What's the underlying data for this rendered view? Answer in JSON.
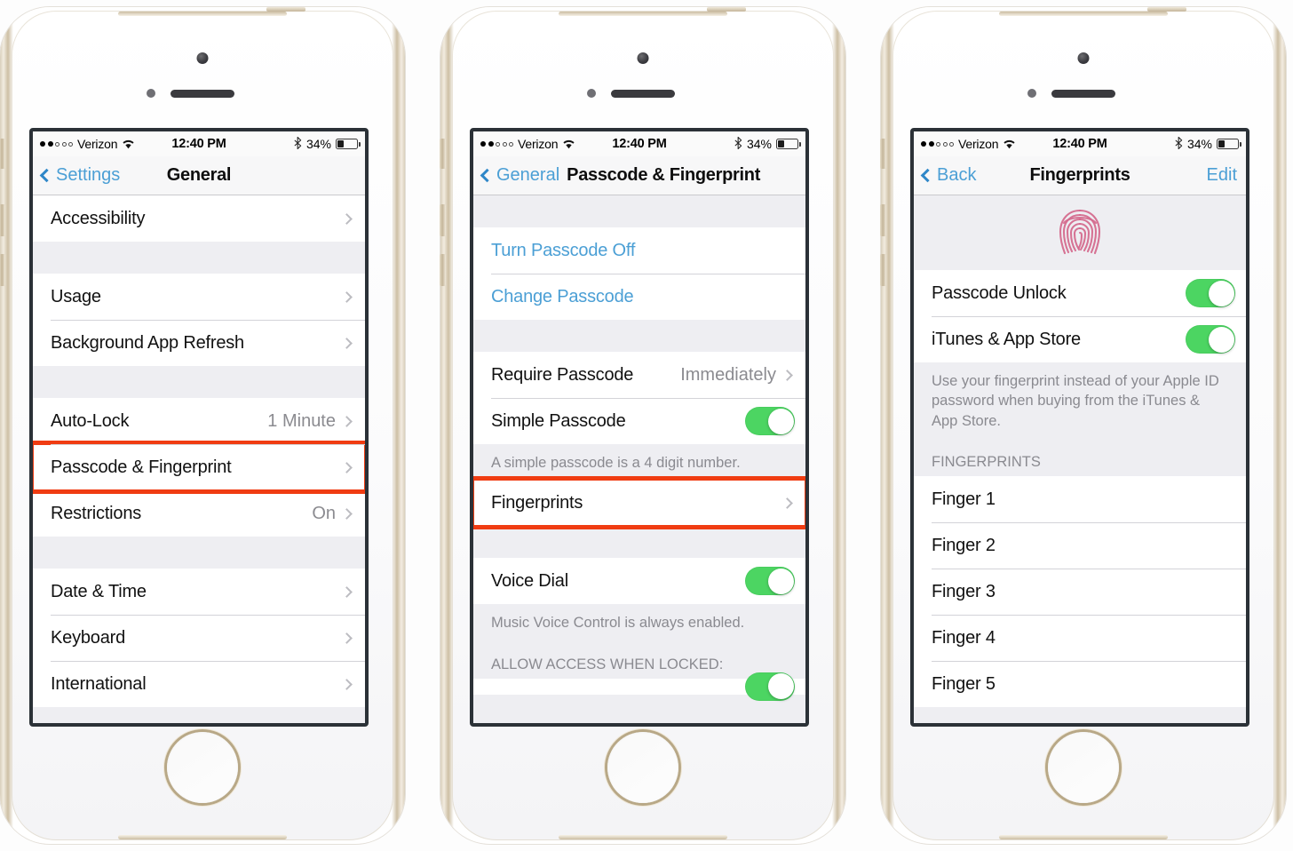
{
  "status_bar": {
    "carrier": "Verizon",
    "signal_dots_filled": 2,
    "signal_dots_total": 5,
    "wifi_icon": "wifi-icon",
    "time": "12:40 PM",
    "bluetooth_icon": "bluetooth-icon",
    "battery_percent": "34%",
    "battery_level": 34
  },
  "colors": {
    "accent_blue": "#4b9fd5",
    "toggle_green": "#4cd562",
    "highlight_red": "#f03c12",
    "fingerprint_pink": "#d4688c",
    "value_gray": "#8b8b90",
    "group_bg": "#eeeef2"
  },
  "phones": [
    {
      "id": "phone-general",
      "nav": {
        "back_label": "Settings",
        "title": "General",
        "title_centered": true,
        "edit_label": null
      },
      "sections": [
        {
          "top_gap": 0,
          "rows": [
            {
              "label": "Accessibility",
              "value": null,
              "chevron": true,
              "type": "link"
            }
          ],
          "footer": null
        },
        {
          "top_gap": 36,
          "rows": [
            {
              "label": "Usage",
              "value": null,
              "chevron": true,
              "type": "link"
            },
            {
              "label": "Background App Refresh",
              "value": null,
              "chevron": true,
              "type": "link"
            }
          ],
          "footer": null
        },
        {
          "top_gap": 36,
          "rows": [
            {
              "label": "Auto-Lock",
              "value": "1 Minute",
              "chevron": true,
              "type": "link"
            },
            {
              "label": "Passcode & Fingerprint",
              "value": null,
              "chevron": true,
              "type": "link",
              "highlighted": true
            },
            {
              "label": "Restrictions",
              "value": "On",
              "chevron": true,
              "type": "link"
            }
          ],
          "footer": null
        },
        {
          "top_gap": 36,
          "rows": [
            {
              "label": "Date & Time",
              "value": null,
              "chevron": true,
              "type": "link"
            },
            {
              "label": "Keyboard",
              "value": null,
              "chevron": true,
              "type": "link"
            },
            {
              "label": "International",
              "value": null,
              "chevron": true,
              "type": "link"
            }
          ],
          "footer": null
        }
      ]
    },
    {
      "id": "phone-passcode",
      "nav": {
        "back_label": "General",
        "title": "Passcode & Fingerprint",
        "title_centered": false,
        "edit_label": null
      },
      "sections": [
        {
          "top_gap": 36,
          "rows": [
            {
              "label": "Turn Passcode Off",
              "value": null,
              "chevron": false,
              "type": "action"
            },
            {
              "label": "Change Passcode",
              "value": null,
              "chevron": false,
              "type": "action"
            }
          ],
          "footer": null
        },
        {
          "top_gap": 36,
          "rows": [
            {
              "label": "Require Passcode",
              "value": "Immediately",
              "chevron": true,
              "type": "link"
            },
            {
              "label": "Simple Passcode",
              "value": null,
              "chevron": false,
              "type": "toggle",
              "toggle_on": true
            }
          ],
          "footer": "A simple passcode is a 4 digit number."
        },
        {
          "top_gap": 0,
          "rows": [
            {
              "label": "Fingerprints",
              "value": null,
              "chevron": true,
              "type": "link",
              "highlighted": true
            }
          ],
          "footer": null
        },
        {
          "top_gap": 36,
          "rows": [
            {
              "label": "Voice Dial",
              "value": null,
              "chevron": false,
              "type": "toggle",
              "toggle_on": true
            }
          ],
          "footer": "Music Voice Control is always enabled."
        },
        {
          "top_gap": 0,
          "header": "ALLOW ACCESS WHEN LOCKED:",
          "rows": [
            {
              "label": "",
              "value": null,
              "chevron": false,
              "type": "toggle",
              "toggle_on": true,
              "clipped": true
            }
          ],
          "footer": null
        }
      ]
    },
    {
      "id": "phone-fingerprints",
      "nav": {
        "back_label": "Back",
        "title": "Fingerprints",
        "title_centered": true,
        "edit_label": "Edit"
      },
      "hero_icon": "fingerprint-icon",
      "sections": [
        {
          "top_gap": 0,
          "hero": true,
          "rows": [
            {
              "label": "Passcode Unlock",
              "value": null,
              "chevron": false,
              "type": "toggle",
              "toggle_on": true
            },
            {
              "label": "iTunes & App Store",
              "value": null,
              "chevron": false,
              "type": "toggle",
              "toggle_on": true
            }
          ],
          "footer": "Use your fingerprint instead of your Apple ID password when buying from the iTunes & App Store."
        },
        {
          "top_gap": 0,
          "header": "FINGERPRINTS",
          "rows": [
            {
              "label": "Finger 1",
              "value": null,
              "chevron": false,
              "type": "link"
            },
            {
              "label": "Finger 2",
              "value": null,
              "chevron": false,
              "type": "link"
            },
            {
              "label": "Finger 3",
              "value": null,
              "chevron": false,
              "type": "link"
            },
            {
              "label": "Finger 4",
              "value": null,
              "chevron": false,
              "type": "link"
            },
            {
              "label": "Finger 5",
              "value": null,
              "chevron": false,
              "type": "link"
            }
          ],
          "footer": null
        }
      ]
    }
  ]
}
